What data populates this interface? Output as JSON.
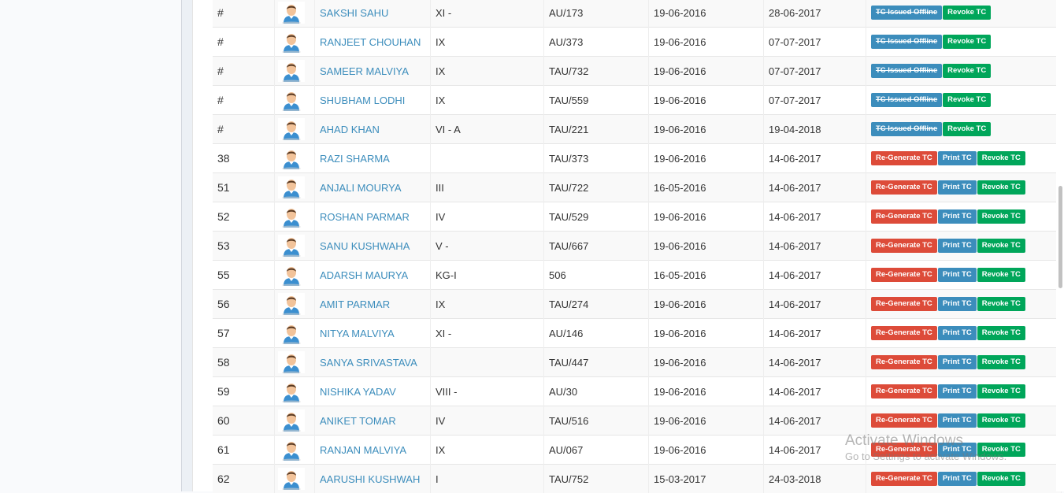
{
  "rows": [
    {
      "idx": "#",
      "name": "SAKSHI SAHU",
      "class": "XI -",
      "adm": "AU/173",
      "d1": "19-06-2016",
      "d2": "28-06-2017",
      "actions": [
        "TC Issued Offline",
        "Revoke TC"
      ]
    },
    {
      "idx": "#",
      "name": "RANJEET CHOUHAN",
      "class": "IX",
      "adm": "AU/373",
      "d1": "19-06-2016",
      "d2": "07-07-2017",
      "actions": [
        "TC Issued Offline",
        "Revoke TC"
      ]
    },
    {
      "idx": "#",
      "name": "SAMEER MALVIYA",
      "class": "IX",
      "adm": "TAU/732",
      "d1": "19-06-2016",
      "d2": "07-07-2017",
      "actions": [
        "TC Issued Offline",
        "Revoke TC"
      ]
    },
    {
      "idx": "#",
      "name": "SHUBHAM LODHI",
      "class": "IX",
      "adm": "TAU/559",
      "d1": "19-06-2016",
      "d2": "07-07-2017",
      "actions": [
        "TC Issued Offline",
        "Revoke TC"
      ]
    },
    {
      "idx": "#",
      "name": "AHAD KHAN",
      "class": "VI - A",
      "adm": "TAU/221",
      "d1": "19-06-2016",
      "d2": "19-04-2018",
      "actions": [
        "TC Issued Offline",
        "Revoke TC"
      ]
    },
    {
      "idx": "38",
      "name": "RAZI SHARMA",
      "class": "",
      "adm": "TAU/373",
      "d1": "19-06-2016",
      "d2": "14-06-2017",
      "actions": [
        "Re-Generate TC",
        "Print TC",
        "Revoke TC"
      ]
    },
    {
      "idx": "51",
      "name": "ANJALI MOURYA",
      "class": "III",
      "adm": "TAU/722",
      "d1": "16-05-2016",
      "d2": "14-06-2017",
      "actions": [
        "Re-Generate TC",
        "Print TC",
        "Revoke TC"
      ]
    },
    {
      "idx": "52",
      "name": "ROSHAN PARMAR",
      "class": "IV",
      "adm": "TAU/529",
      "d1": "19-06-2016",
      "d2": "14-06-2017",
      "actions": [
        "Re-Generate TC",
        "Print TC",
        "Revoke TC"
      ]
    },
    {
      "idx": "53",
      "name": "SANU KUSHWAHA",
      "class": "V -",
      "adm": "TAU/667",
      "d1": "19-06-2016",
      "d2": "14-06-2017",
      "actions": [
        "Re-Generate TC",
        "Print TC",
        "Revoke TC"
      ]
    },
    {
      "idx": "55",
      "name": "ADARSH MAURYA",
      "class": "KG-I",
      "adm": "506",
      "d1": "16-05-2016",
      "d2": "14-06-2017",
      "actions": [
        "Re-Generate TC",
        "Print TC",
        "Revoke TC"
      ]
    },
    {
      "idx": "56",
      "name": "AMIT PARMAR",
      "class": "IX",
      "adm": "TAU/274",
      "d1": "19-06-2016",
      "d2": "14-06-2017",
      "actions": [
        "Re-Generate TC",
        "Print TC",
        "Revoke TC"
      ]
    },
    {
      "idx": "57",
      "name": "NITYA MALVIYA",
      "class": "XI -",
      "adm": "AU/146",
      "d1": "19-06-2016",
      "d2": "14-06-2017",
      "actions": [
        "Re-Generate TC",
        "Print TC",
        "Revoke TC"
      ]
    },
    {
      "idx": "58",
      "name": "SANYA SRIVASTAVA",
      "class": "",
      "adm": "TAU/447",
      "d1": "19-06-2016",
      "d2": "14-06-2017",
      "actions": [
        "Re-Generate TC",
        "Print TC",
        "Revoke TC"
      ]
    },
    {
      "idx": "59",
      "name": "NISHIKA YADAV",
      "class": "VIII -",
      "adm": "AU/30",
      "d1": "19-06-2016",
      "d2": "14-06-2017",
      "actions": [
        "Re-Generate TC",
        "Print TC",
        "Revoke TC"
      ]
    },
    {
      "idx": "60",
      "name": "ANIKET TOMAR",
      "class": "IV",
      "adm": "TAU/516",
      "d1": "19-06-2016",
      "d2": "14-06-2017",
      "actions": [
        "Re-Generate TC",
        "Print TC",
        "Revoke TC"
      ]
    },
    {
      "idx": "61",
      "name": "RANJAN MALVIYA",
      "class": "IX",
      "adm": "AU/067",
      "d1": "19-06-2016",
      "d2": "14-06-2017",
      "actions": [
        "Re-Generate TC",
        "Print TC",
        "Revoke TC"
      ]
    },
    {
      "idx": "62",
      "name": "AARUSHI KUSHWAH",
      "class": "I",
      "adm": "TAU/752",
      "d1": "15-03-2017",
      "d2": "24-03-2018",
      "actions": [
        "Re-Generate TC",
        "Print TC",
        "Revoke TC"
      ]
    }
  ],
  "colors": {
    "link": "#3c8dbc",
    "issued": "#3c8dbc",
    "regenerate": "#dd4b39",
    "print": "#3c8dbc",
    "revoke": "#00a65a"
  },
  "icons": {
    "avatar": "student-avatar-icon"
  },
  "watermark": {
    "title": "Activate Windows",
    "subtitle": "Go to Settings to activate Windows."
  }
}
